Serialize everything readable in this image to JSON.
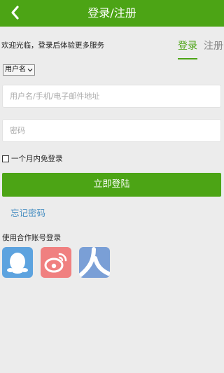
{
  "header": {
    "title": "登录/注册",
    "back_icon": "chevron-left-icon"
  },
  "welcome_text": "欢迎光临，登录后体验更多服务",
  "tabs": {
    "login": "登录",
    "register": "注册"
  },
  "account_type": {
    "selected": "用户名"
  },
  "fields": {
    "username_placeholder": "用户名/手机/电子邮件地址",
    "password_placeholder": "密码"
  },
  "remember_label": "一个月内免登录",
  "login_button": "立即登陆",
  "forgot_password": "忘记密码",
  "partner_login_label": "使用合作账号登录",
  "social": [
    {
      "name": "qq",
      "icon": "qq-penguin-icon",
      "color": "#5da3df"
    },
    {
      "name": "weibo",
      "icon": "weibo-icon",
      "color": "#f08080"
    },
    {
      "name": "renren",
      "icon": "renren-icon",
      "color": "#7a9fd6"
    }
  ],
  "colors": {
    "accent": "#4ca415",
    "link": "#4a90c2",
    "background": "#ececec"
  }
}
